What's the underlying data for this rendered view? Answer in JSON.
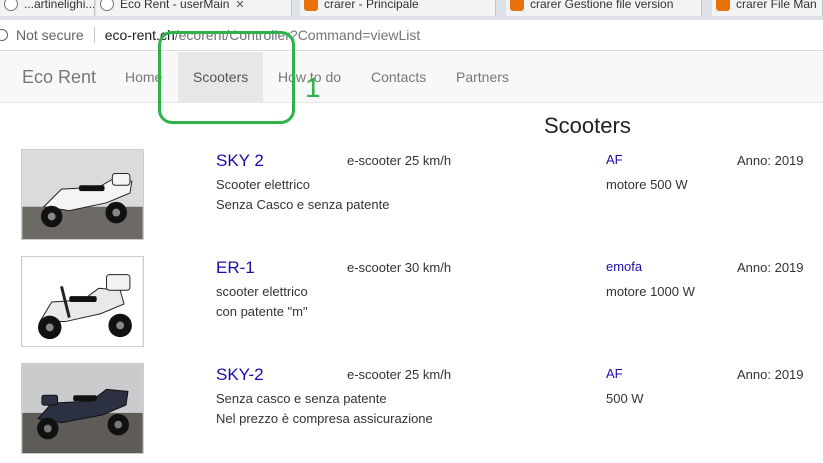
{
  "browser": {
    "tabs": [
      {
        "title": "...artinelighi...",
        "icon": "globe-icon"
      },
      {
        "title": "Eco Rent - userMain",
        "icon": "globe-icon"
      },
      {
        "title": "crarer - Principale",
        "icon": "extension-icon"
      },
      {
        "title": "crarer Gestione file version",
        "icon": "extension-icon"
      },
      {
        "title": "crarer File Man",
        "icon": "extension-icon"
      }
    ],
    "security_label": "Not secure",
    "url_host": "eco-rent.ch",
    "url_path": "/ecorent/Controller?Command=viewList"
  },
  "nav": {
    "brand": "Eco Rent",
    "links": [
      "Home",
      "Scooters",
      "How to do",
      "Contacts",
      "Partners"
    ],
    "active": "Scooters"
  },
  "annotation": {
    "label": "1",
    "color": "#2db34a"
  },
  "page": {
    "heading": "Scooters",
    "items": [
      {
        "name": "SKY 2",
        "speed": "e-scooter 25 km/h",
        "desc1": "Scooter elettrico",
        "desc2": "Senza Casco e senza patente",
        "brand": "AF",
        "power": "motore 500 W",
        "year": "Anno: 2019"
      },
      {
        "name": "ER-1",
        "speed": "e-scooter 30 km/h",
        "desc1": "scooter elettrico",
        "desc2": "con patente \"m\"",
        "brand": "emofa",
        "power": "motore 1000 W",
        "year": "Anno: 2019"
      },
      {
        "name": "SKY-2",
        "speed": "e-scooter 25 km/h",
        "desc1": "Senza casco e senza patente",
        "desc2": "Nel prezzo è compresa assicurazione",
        "brand": "AF",
        "power": "500 W",
        "year": "Anno: 2019"
      }
    ]
  }
}
